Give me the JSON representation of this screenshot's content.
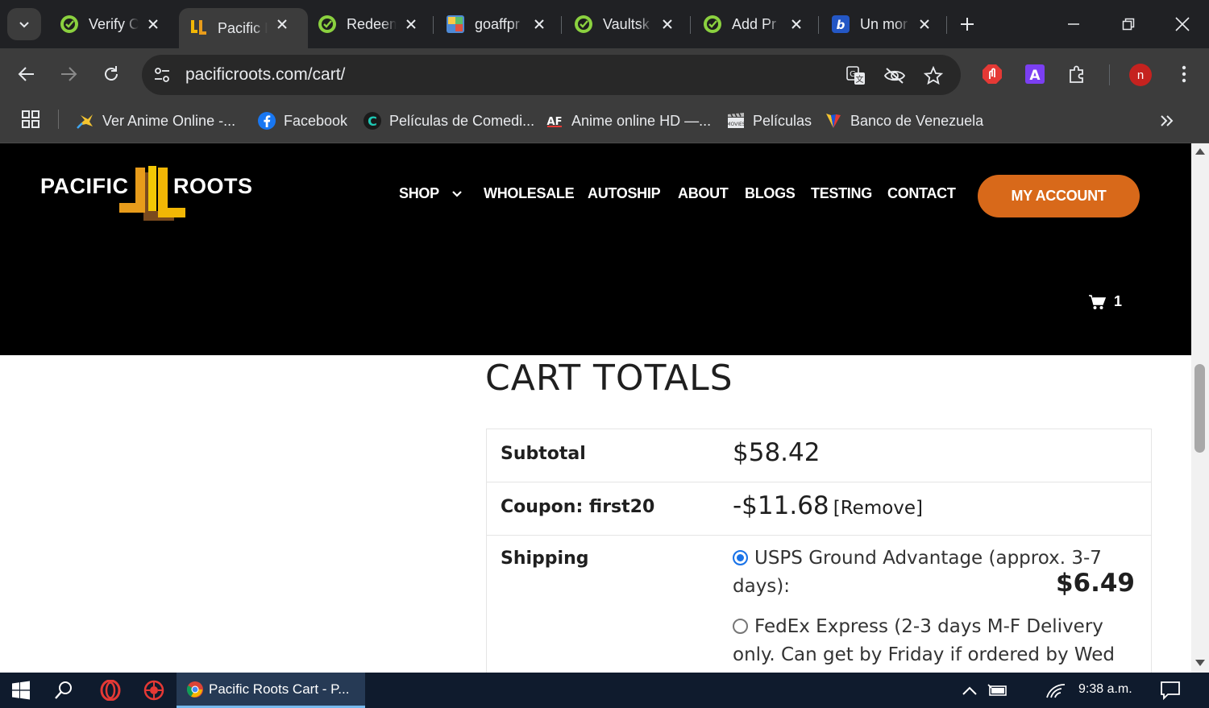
{
  "browser": {
    "tabs": [
      {
        "label": "Verify C",
        "icon": "vaultsafe-check-icon"
      },
      {
        "label": "Pacific I",
        "icon": "pacific-roots-icon",
        "active": true
      },
      {
        "label": "Redeem",
        "icon": "vaultsafe-check-icon"
      },
      {
        "label": "goaffpr",
        "icon": "goaffpro-icon"
      },
      {
        "label": "Vaultsk",
        "icon": "vaultsafe-check-icon"
      },
      {
        "label": "Add Pr",
        "icon": "vaultsafe-check-icon"
      },
      {
        "label": "Un mor",
        "icon": "b-letter-icon"
      }
    ],
    "url": "pacificroots.com/cart/",
    "profile_initial": "n",
    "bookmarks": [
      {
        "label": "Ver Anime Online -...",
        "icon": "anime-star-icon"
      },
      {
        "label": "Facebook",
        "icon": "facebook-icon"
      },
      {
        "label": "Películas de Comedi...",
        "icon": "c-letter-icon"
      },
      {
        "label": "Anime online HD —...",
        "icon": "af-letter-icon"
      },
      {
        "label": "Películas",
        "icon": "movie-clapper-icon"
      },
      {
        "label": "Banco de Venezuela",
        "icon": "banco-venezuela-icon"
      }
    ]
  },
  "site": {
    "logo_left": "PACIFIC",
    "logo_right": "ROOTS",
    "nav": {
      "shop": "SHOP",
      "wholesale": "WHOLESALE",
      "autoship": "AUTOSHIP",
      "about": "ABOUT",
      "blogs": "BLOGS",
      "testing": "TESTING",
      "contact": "CONTACT"
    },
    "account_button": "MY ACCOUNT",
    "cart_count": "1",
    "brand_color": "#d8691a"
  },
  "cart_totals": {
    "title": "CART TOTALS",
    "subtotal_label": "Subtotal",
    "subtotal_value": "$58.42",
    "coupon_label": "Coupon: first20",
    "coupon_value": "-$11.68",
    "coupon_remove": "[Remove]",
    "shipping_label": "Shipping",
    "shipping_options": [
      {
        "label": "USPS Ground Advantage (approx. 3-7 days):",
        "price": "$6.49",
        "selected": true
      },
      {
        "label": "FedEx Express (2-3 days M-F Delivery only. Can get by Friday if ordered by Wed",
        "selected": false
      }
    ]
  },
  "taskbar": {
    "active_app": "Pacific Roots Cart - P...",
    "time": "9:38 a.m."
  }
}
